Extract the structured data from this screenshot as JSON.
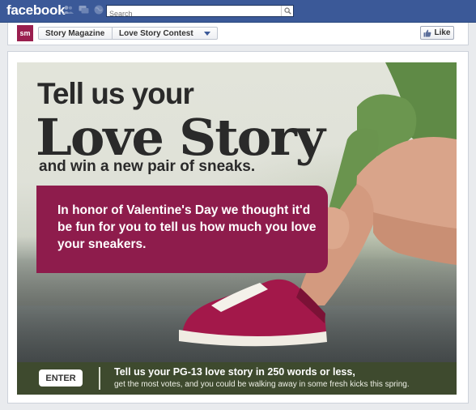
{
  "topbar": {
    "logo": "facebook",
    "search_placeholder": "Search"
  },
  "pagebar": {
    "logo_text": "sm",
    "breadcrumb_page": "Story Magazine",
    "breadcrumb_tab": "Love Story Contest",
    "like_label": "Like"
  },
  "hero": {
    "line1": "Tell us your",
    "line2": "Love Story",
    "line3": "and win a new pair of sneaks.",
    "promo": "In honor of Valentine's Day we thought it'd be fun for you to tell us how much you love your sneakers."
  },
  "cta": {
    "enter_label": "ENTER",
    "headline": "Tell us your PG-13 love story in 250 words or less,",
    "subline": "get the most votes, and you could be walking away in some fresh kicks this spring."
  },
  "colors": {
    "facebook_blue": "#3b5998",
    "promo_magenta": "#8e1c4c",
    "cta_bar": "#3e4a2e",
    "sneaker": "#a3184a"
  }
}
